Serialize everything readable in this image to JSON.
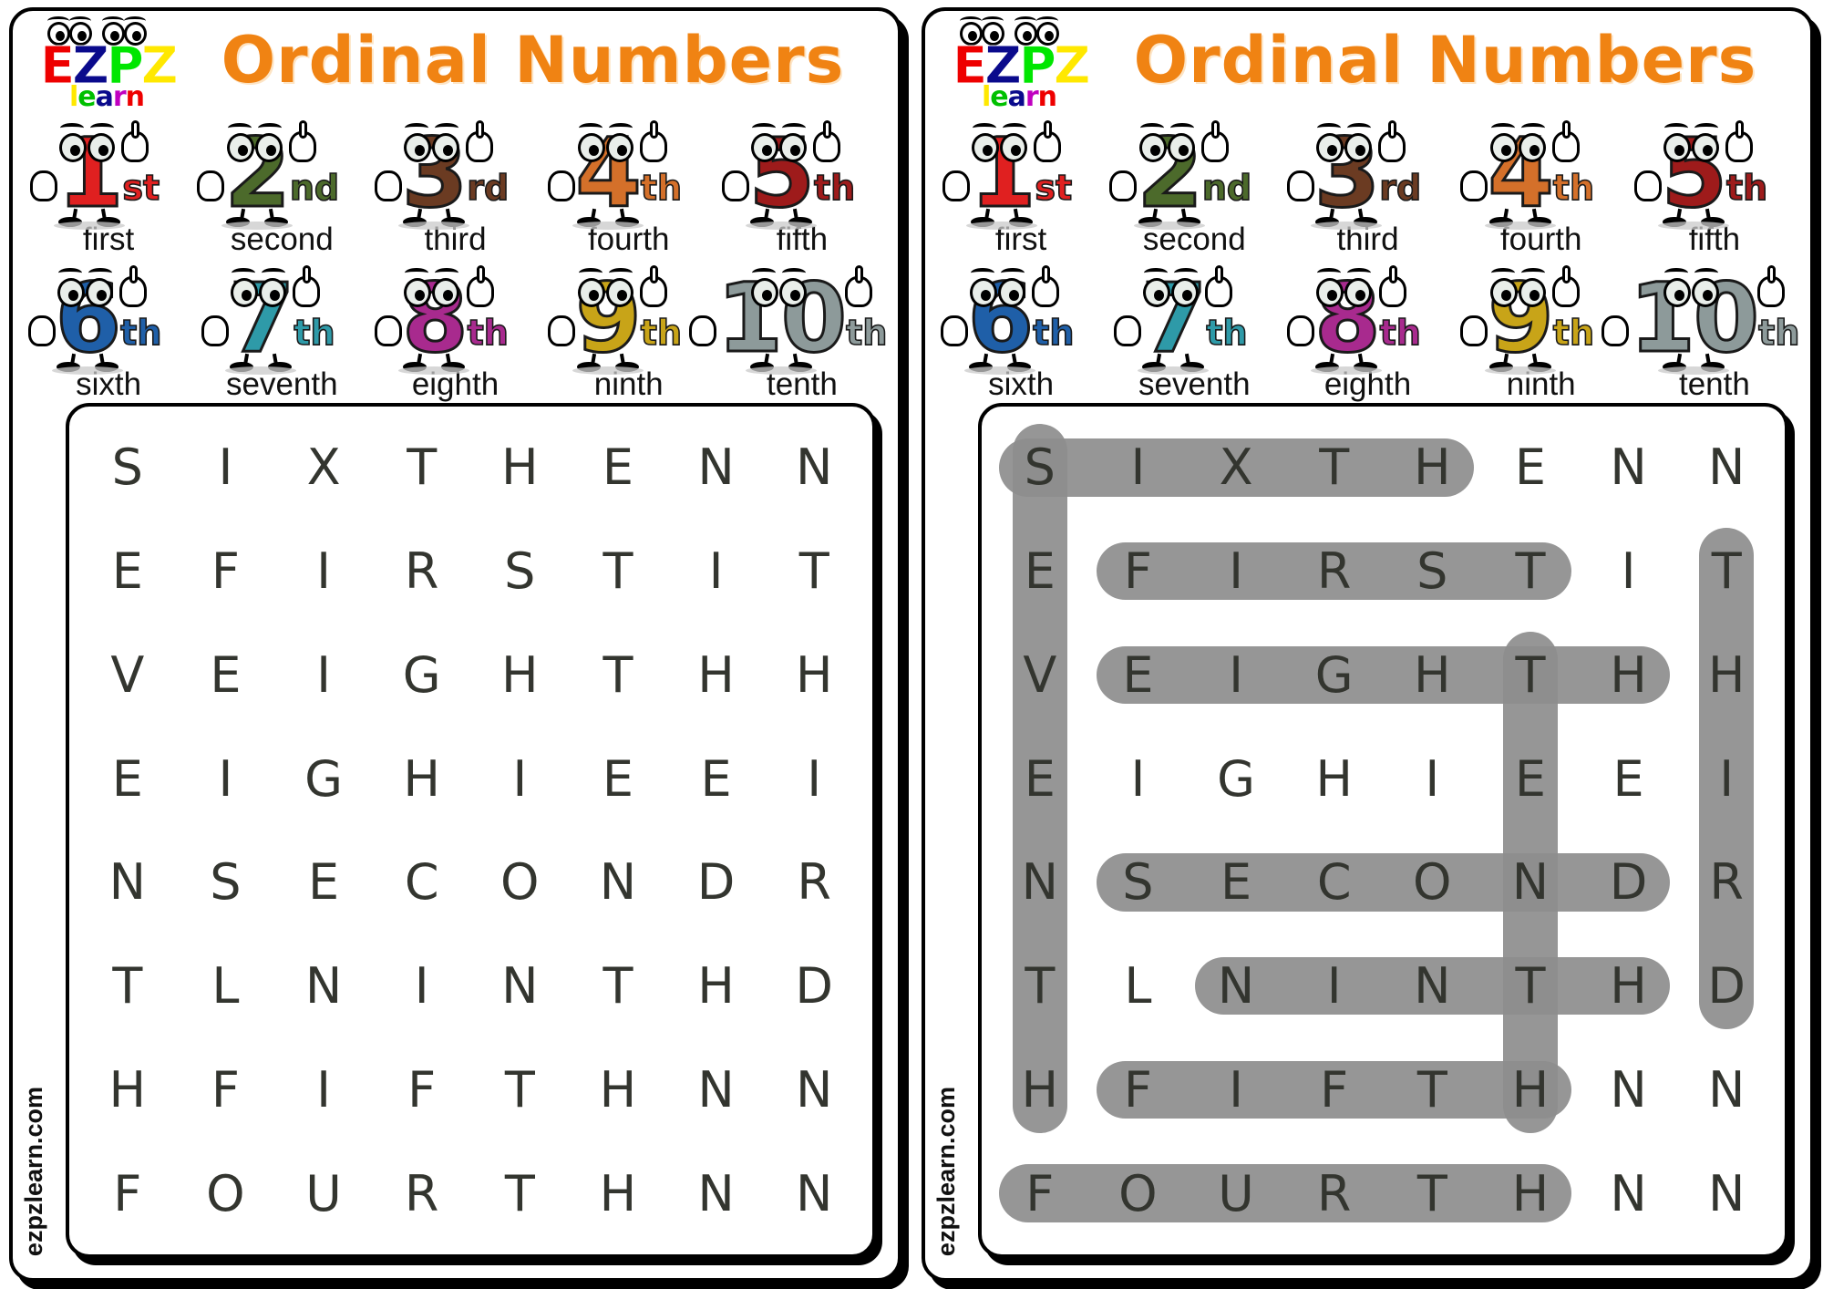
{
  "title": "Ordinal Numbers",
  "logo": {
    "letters": [
      {
        "ch": "E",
        "color": "#ee0000"
      },
      {
        "ch": "Z",
        "color": "#0a0a8c"
      },
      {
        "ch": "P",
        "color": "#00e600"
      },
      {
        "ch": "Z",
        "color": "#ffe800"
      }
    ],
    "learn": [
      {
        "ch": "l",
        "color": "#ffe800"
      },
      {
        "ch": "e",
        "color": "#00c000"
      },
      {
        "ch": "a",
        "color": "#0a0a8c"
      },
      {
        "ch": "r",
        "color": "#c000c0"
      },
      {
        "ch": "n",
        "color": "#ee0000"
      }
    ]
  },
  "watermark": "ezpzlearn.com",
  "numbers": [
    {
      "digit": "1",
      "suffix": "st",
      "word": "first",
      "color": "#e02020",
      "hand": "one"
    },
    {
      "digit": "2",
      "suffix": "nd",
      "word": "second",
      "color": "#4c6a2b",
      "hand": "two"
    },
    {
      "digit": "3",
      "suffix": "rd",
      "word": "third",
      "color": "#6b3b22",
      "hand": "three"
    },
    {
      "digit": "4",
      "suffix": "th",
      "word": "fourth",
      "color": "#d4702a",
      "hand": "four"
    },
    {
      "digit": "5",
      "suffix": "th",
      "word": "fifth",
      "color": "#9e1b1b",
      "hand": "five"
    },
    {
      "digit": "6",
      "suffix": "th",
      "word": "sixth",
      "color": "#1f5fa8",
      "hand": "six"
    },
    {
      "digit": "7",
      "suffix": "th",
      "word": "seventh",
      "color": "#2e9aa8",
      "hand": "seven"
    },
    {
      "digit": "8",
      "suffix": "th",
      "word": "eighth",
      "color": "#a82a8e",
      "hand": "eight"
    },
    {
      "digit": "9",
      "suffix": "th",
      "word": "ninth",
      "color": "#c8a418",
      "hand": "nine"
    },
    {
      "digit": "10",
      "suffix": "th",
      "word": "tenth",
      "color": "#8d9a9a",
      "hand": "ten"
    }
  ],
  "puzzle": {
    "rows": 8,
    "cols": 8,
    "grid": [
      [
        "S",
        "I",
        "X",
        "T",
        "H",
        "E",
        "N",
        "N"
      ],
      [
        "E",
        "F",
        "I",
        "R",
        "S",
        "T",
        "I",
        "T"
      ],
      [
        "V",
        "E",
        "I",
        "G",
        "H",
        "T",
        "H",
        "H"
      ],
      [
        "E",
        "I",
        "G",
        "H",
        "I",
        "E",
        "E",
        "I"
      ],
      [
        "N",
        "S",
        "E",
        "C",
        "O",
        "N",
        "D",
        "R"
      ],
      [
        "T",
        "L",
        "N",
        "I",
        "N",
        "T",
        "H",
        "D"
      ],
      [
        "H",
        "F",
        "I",
        "F",
        "T",
        "H",
        "N",
        "N"
      ],
      [
        "F",
        "O",
        "U",
        "R",
        "T",
        "H",
        "N",
        "N"
      ]
    ],
    "highlight_color": "#8d8d8d",
    "solutions": [
      {
        "word": "SIXTH",
        "dir": "across",
        "row": 0,
        "col": 0,
        "len": 5
      },
      {
        "word": "SEVENTH",
        "dir": "down",
        "row": 0,
        "col": 0,
        "len": 7
      },
      {
        "word": "FIRST",
        "dir": "across",
        "row": 1,
        "col": 1,
        "len": 5
      },
      {
        "word": "EIGHTH",
        "dir": "across",
        "row": 2,
        "col": 1,
        "len": 6
      },
      {
        "word": "THIRD",
        "dir": "down",
        "row": 1,
        "col": 7,
        "len": 5
      },
      {
        "word": "TENTH",
        "dir": "down",
        "row": 2,
        "col": 5,
        "len": 5
      },
      {
        "word": "SECOND",
        "dir": "across",
        "row": 4,
        "col": 1,
        "len": 6
      },
      {
        "word": "NINTH",
        "dir": "across",
        "row": 5,
        "col": 2,
        "len": 5
      },
      {
        "word": "FIFTH",
        "dir": "across",
        "row": 6,
        "col": 1,
        "len": 5
      },
      {
        "word": "FOURTH",
        "dir": "across",
        "row": 7,
        "col": 0,
        "len": 6
      }
    ]
  },
  "panels": [
    {
      "id": "worksheet",
      "show_answers": false
    },
    {
      "id": "answer-key",
      "show_answers": true
    }
  ]
}
